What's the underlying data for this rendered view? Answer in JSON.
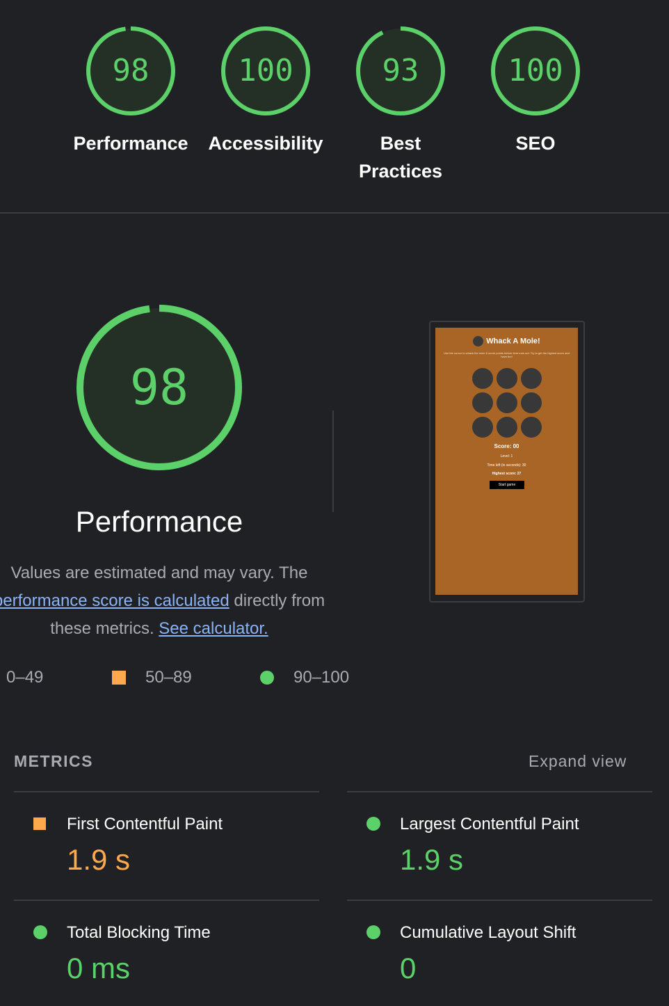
{
  "colors": {
    "pass": "#5cd16a",
    "average": "#ffa94d",
    "background": "#202124",
    "link": "#8ab4f8"
  },
  "categories": [
    {
      "label": "Performance",
      "score": "98",
      "score_value": 98,
      "icon": "score-gauge-icon"
    },
    {
      "label": "Accessibility",
      "score": "100",
      "score_value": 100,
      "icon": "score-gauge-icon"
    },
    {
      "label": "Best Practices",
      "score": "93",
      "score_value": 93,
      "icon": "score-gauge-icon"
    },
    {
      "label": "SEO",
      "score": "100",
      "score_value": 100,
      "icon": "score-gauge-icon"
    }
  ],
  "performance": {
    "score": "98",
    "score_value": 98,
    "title": "Performance",
    "description_1": "Values are estimated and may vary. The",
    "link_1": "performance score is calculated",
    "description_2": " directly from",
    "description_3": "these metrics. ",
    "link_2": "See calculator."
  },
  "legend": [
    {
      "range": "0–49",
      "icon": "fail-triangle-icon"
    },
    {
      "range": "50–89",
      "icon": "average-square-icon"
    },
    {
      "range": "90–100",
      "icon": "pass-circle-icon"
    }
  ],
  "screenshot": {
    "title": "Whack A Mole!",
    "subtitle": "Use the cursor to whack the mole & score points before time runs out. Try to get the highest score and have fun!",
    "score": "Score: 00",
    "level": "Level: 1",
    "time_left": "Time left (in seconds): 30",
    "highest_score": "Highest score: 27",
    "start_button": "Start game"
  },
  "metrics": {
    "heading": "METRICS",
    "expand_label": "Expand view",
    "items": [
      {
        "name": "First Contentful Paint",
        "value": "1.9 s",
        "status": "average",
        "icon": "average-square-icon"
      },
      {
        "name": "Largest Contentful Paint",
        "value": "1.9 s",
        "status": "pass",
        "icon": "pass-circle-icon"
      },
      {
        "name": "Total Blocking Time",
        "value": "0 ms",
        "status": "pass",
        "icon": "pass-circle-icon"
      },
      {
        "name": "Cumulative Layout Shift",
        "value": "0",
        "status": "pass",
        "icon": "pass-circle-icon"
      }
    ]
  }
}
